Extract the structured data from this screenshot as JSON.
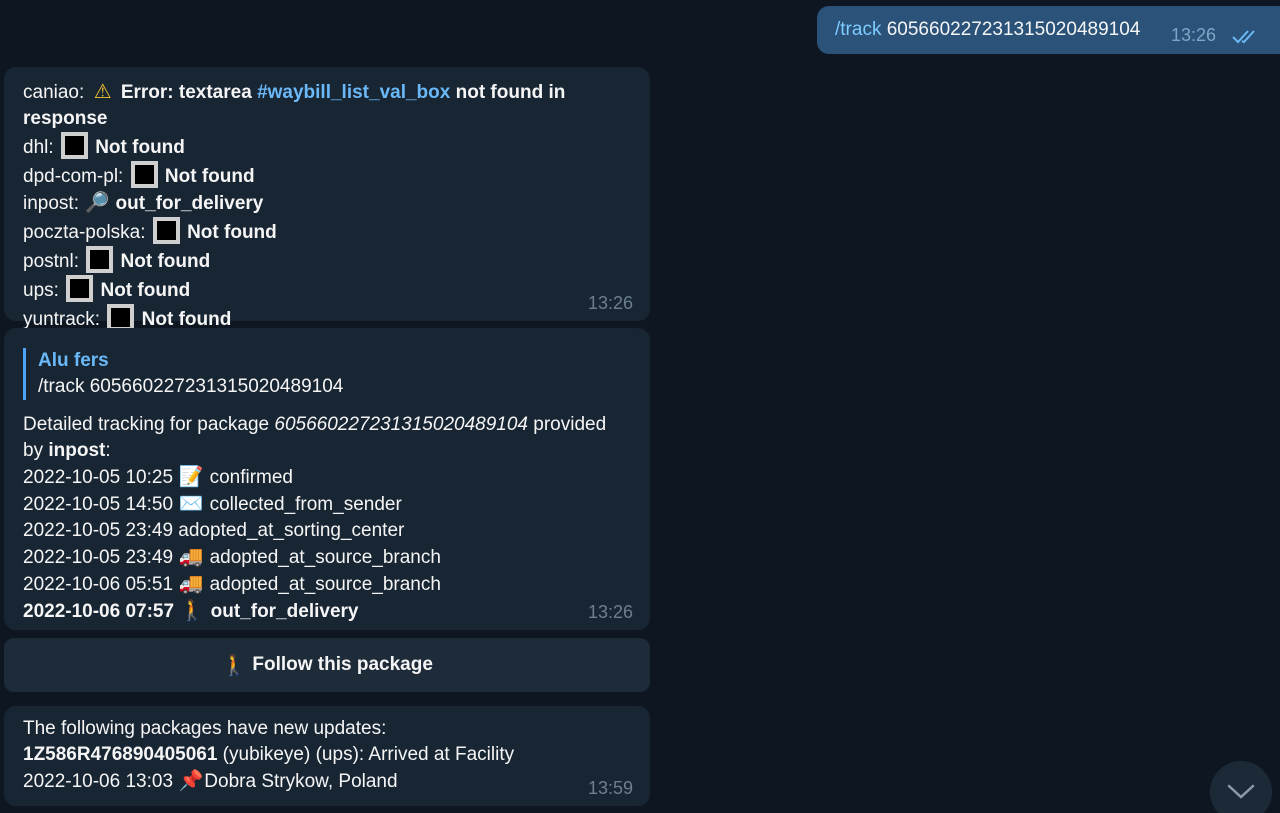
{
  "outgoing": {
    "command": "/track",
    "tracking_number": "605660227231315020489104",
    "time": "13:26",
    "status_icon": "double-check-icon"
  },
  "message1": {
    "line1_prefix": "caniao: ",
    "line1_error": "Error: textarea ",
    "line1_tag": "#waybill_list_val_box",
    "line1_suffix": " not found in",
    "line2": "response",
    "carriers": [
      {
        "name": "dhl:",
        "status": "Not found"
      },
      {
        "name": "dpd-com-pl:",
        "status": "Not found"
      },
      {
        "name": "inpost:",
        "status": "out_for_delivery"
      },
      {
        "name": "poczta-polska:",
        "status": "Not found"
      },
      {
        "name": "postnl:",
        "status": "Not found"
      },
      {
        "name": "ups:",
        "status": "Not found"
      },
      {
        "name": "yuntrack:",
        "status": "Not found"
      }
    ],
    "time": "13:26"
  },
  "message2": {
    "reply_author": "Alu fers",
    "reply_text": "/track 605660227231315020489104",
    "intro_prefix": "Detailed tracking for package ",
    "intro_number": "605660227231315020489104",
    "intro_suffix": " provided",
    "intro_by": "by ",
    "intro_carrier": "inpost",
    "intro_colon": ":",
    "events": [
      {
        "datetime": "2022-10-05 10:25",
        "emoji": "📝",
        "status": "confirmed"
      },
      {
        "datetime": "2022-10-05 14:50",
        "emoji": "✉️",
        "status": "collected_from_sender"
      },
      {
        "datetime": "2022-10-05 23:49",
        "emoji": "",
        "status": "adopted_at_sorting_center"
      },
      {
        "datetime": "2022-10-05 23:49",
        "emoji": "🚚",
        "status": "adopted_at_source_branch"
      },
      {
        "datetime": "2022-10-06 05:51",
        "emoji": "🚚",
        "status": "adopted_at_source_branch"
      },
      {
        "datetime": "2022-10-06 07:57",
        "emoji": "🚶",
        "status": "out_for_delivery"
      }
    ],
    "time": "13:26"
  },
  "follow_button": {
    "emoji": "🚶",
    "label": "Follow this package"
  },
  "message3": {
    "line1": "The following packages have new updates:",
    "tracking": "1Z586R476890405061",
    "detail": " (yubikeye) (ups): Arrived at Facility",
    "datetime": "2022-10-06 13:03",
    "pin_emoji": "📌",
    "location": "Dobra Strykow, Poland",
    "time": "13:59"
  },
  "colors": {
    "background": "#0e1621",
    "incoming_bubble": "#182533",
    "outgoing_bubble": "#2b5278",
    "link": "#6ab8f7"
  }
}
